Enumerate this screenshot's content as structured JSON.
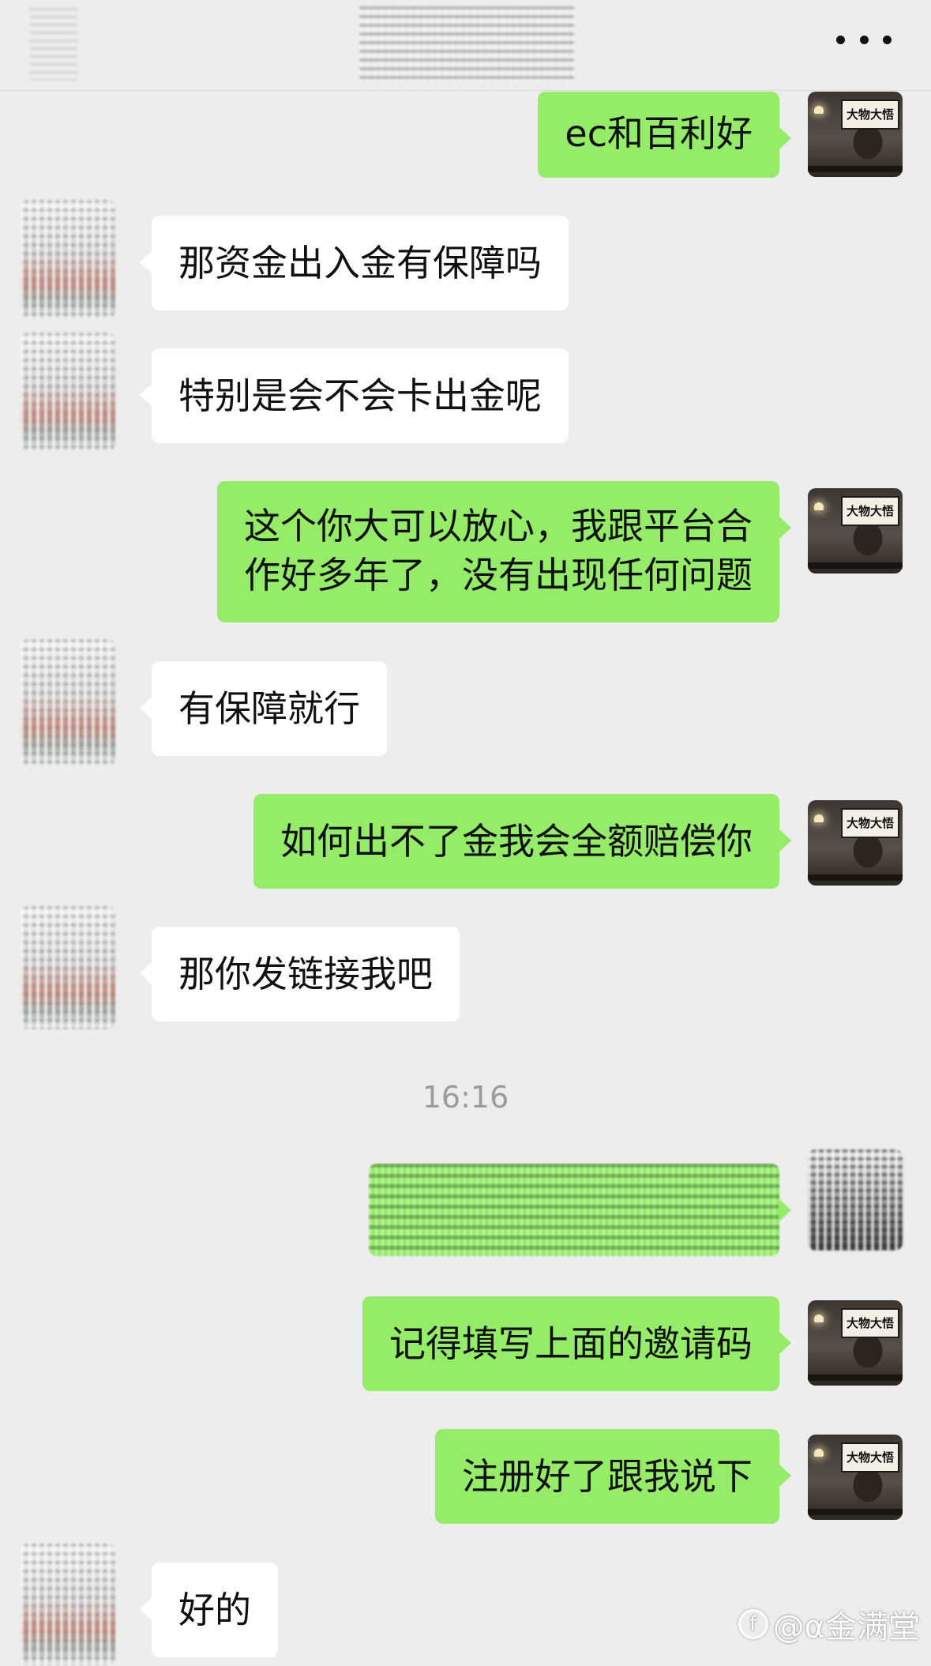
{
  "header": {
    "more_icon": "more-dots-icon"
  },
  "messages": [
    {
      "side": "out",
      "text": "ec和百利好"
    },
    {
      "side": "in",
      "text": "那资金出入金有保障吗"
    },
    {
      "side": "in",
      "text": "特别是会不会卡出金呢"
    },
    {
      "side": "out",
      "text": "这个你大可以放心，我跟平台合\n作好多年了，没有出现任何问题"
    },
    {
      "side": "in",
      "text": "有保障就行"
    },
    {
      "side": "out",
      "text": "如何出不了金我会全额赔偿你"
    },
    {
      "side": "in",
      "text": "那你发链接我吧"
    },
    {
      "side": "out",
      "text": "记得填写上面的邀请码"
    },
    {
      "side": "out",
      "text": "注册好了跟我说下"
    },
    {
      "side": "in",
      "text": "好的"
    }
  ],
  "timestamp": "16:16",
  "self_avatar_sign": "大物大悟",
  "watermark": {
    "icon": "zhihu-icon",
    "icon_glyph": "f",
    "text": "@α金满堂"
  },
  "colors": {
    "background": "#ededed",
    "outgoing_bubble": "#95ec69",
    "incoming_bubble": "#ffffff",
    "timestamp": "#9b9b9b"
  }
}
